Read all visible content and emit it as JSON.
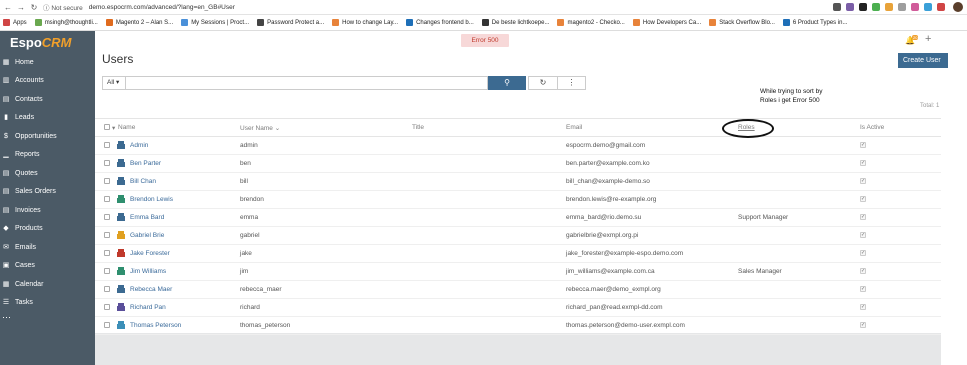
{
  "browser": {
    "url_info": "Not secure",
    "url": "demo.espocrm.com/advanced/?lang=en_GB#User",
    "bookmarks": [
      {
        "label": "Apps",
        "color": "#d04545"
      },
      {
        "label": "msingh@thoughtli...",
        "color": "#6aa84f"
      },
      {
        "label": "Magento 2 – Alan S...",
        "color": "#e06b1e"
      },
      {
        "label": "My Sessions | Proct...",
        "color": "#4a90d9"
      },
      {
        "label": "Password Protect a...",
        "color": "#444444"
      },
      {
        "label": "How to change Lay...",
        "color": "#e8833a"
      },
      {
        "label": "Changes frontend b...",
        "color": "#1e6fb8"
      },
      {
        "label": "De beste lichtkoepe...",
        "color": "#333333"
      },
      {
        "label": "magento2 - Checko...",
        "color": "#e8833a"
      },
      {
        "label": "How Developers Ca...",
        "color": "#e8833a"
      },
      {
        "label": "Stack Overflow Blo...",
        "color": "#e8833a"
      },
      {
        "label": "6 Product Types in...",
        "color": "#1e6fb8"
      }
    ]
  },
  "app": {
    "logo_main": "Espo",
    "logo_accent": "CRM",
    "error": "Error 500",
    "notification_count": "20"
  },
  "sidebar": {
    "items": [
      {
        "label": "Home",
        "icon": "grid-icon"
      },
      {
        "label": "Accounts",
        "icon": "building-icon"
      },
      {
        "label": "Contacts",
        "icon": "contact-icon"
      },
      {
        "label": "Leads",
        "icon": "leads-icon"
      },
      {
        "label": "Opportunities",
        "icon": "dollar-icon"
      },
      {
        "label": "Reports",
        "icon": "bar-chart-icon"
      },
      {
        "label": "Quotes",
        "icon": "quotes-icon"
      },
      {
        "label": "Sales Orders",
        "icon": "orders-icon"
      },
      {
        "label": "Invoices",
        "icon": "invoice-icon"
      },
      {
        "label": "Products",
        "icon": "box-icon"
      },
      {
        "label": "Emails",
        "icon": "envelope-icon"
      },
      {
        "label": "Cases",
        "icon": "briefcase-icon"
      },
      {
        "label": "Calendar",
        "icon": "calendar-icon"
      },
      {
        "label": "Tasks",
        "icon": "tasks-icon"
      }
    ]
  },
  "page": {
    "title": "Users",
    "create_label": "Create User",
    "filter_label": "All",
    "total_label": "Total: 1",
    "annotation": "While trying to sort by Roles i get Error 500"
  },
  "table": {
    "headers": {
      "name": "Name",
      "username": "User Name",
      "title": "Title",
      "email": "Email",
      "roles": "Roles",
      "active": "Is Active"
    },
    "rows": [
      {
        "name": "Admin",
        "username": "admin",
        "email": "espocrm.demo@gmail.com",
        "roles": "",
        "icon_color": "#3c6a91"
      },
      {
        "name": "Ben Parter",
        "username": "ben",
        "email": "ben.parter@example.com.ko",
        "roles": "",
        "icon_color": "#3c6a91"
      },
      {
        "name": "Bill Chan",
        "username": "bill",
        "email": "bill_chan@example-demo.so",
        "roles": "",
        "icon_color": "#3c6a91"
      },
      {
        "name": "Brendon Lewis",
        "username": "brendon",
        "email": "brendon.lewis@re-example.org",
        "roles": "",
        "icon_color": "#2f8f6f"
      },
      {
        "name": "Emma Bard",
        "username": "emma",
        "email": "emma_bard@rio.demo.su",
        "roles": "Support Manager",
        "icon_color": "#3c6a91"
      },
      {
        "name": "Gabriel Brie",
        "username": "gabriel",
        "email": "gabrielbrie@exmpl.org.pi",
        "roles": "",
        "icon_color": "#e0a020"
      },
      {
        "name": "Jake Forester",
        "username": "jake",
        "email": "jake_forester@example-espo.demo.com",
        "roles": "",
        "icon_color": "#c0392b"
      },
      {
        "name": "Jim Williams",
        "username": "jim",
        "email": "jim_williams@example.com.ca",
        "roles": "Sales Manager",
        "icon_color": "#2f8f6f"
      },
      {
        "name": "Rebecca Maer",
        "username": "rebecca_maer",
        "email": "rebecca.maer@demo_exmpl.org",
        "roles": "",
        "icon_color": "#3c6a91"
      },
      {
        "name": "Richard Pan",
        "username": "richard",
        "email": "richard_pan@read.exmpl-dd.com",
        "roles": "",
        "icon_color": "#5a4f9a"
      },
      {
        "name": "Thomas Peterson",
        "username": "thomas_peterson",
        "email": "thomas.peterson@demo-user.exmpl.com",
        "roles": "",
        "icon_color": "#3c8fb8"
      }
    ]
  }
}
